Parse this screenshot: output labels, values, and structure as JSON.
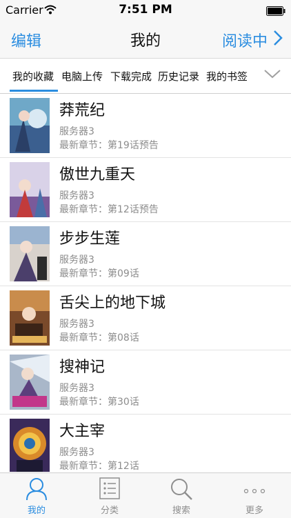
{
  "status": {
    "carrier": "Carrier",
    "time": "7:51 PM"
  },
  "nav": {
    "left": "编辑",
    "title": "我的",
    "right": "阅读中"
  },
  "tabs": [
    "我的收藏",
    "电脑上传",
    "下载完成",
    "历史记录",
    "我的书签"
  ],
  "list": [
    {
      "title": "莽荒纪",
      "server": "服务器3",
      "latest": "最新章节：第19话预告"
    },
    {
      "title": "傲世九重天",
      "server": "服务器3",
      "latest": "最新章节：第12话预告"
    },
    {
      "title": "步步生莲",
      "server": "服务器3",
      "latest": "最新章节：第09话"
    },
    {
      "title": "舌尖上的地下城",
      "server": "服务器3",
      "latest": "最新章节：第08话"
    },
    {
      "title": "搜神记",
      "server": "服务器3",
      "latest": "最新章节：第30话"
    },
    {
      "title": "大主宰",
      "server": "服务器3",
      "latest": "最新章节：第12话"
    }
  ],
  "tabbar": [
    "我的",
    "分类",
    "搜索",
    "更多"
  ],
  "colors": {
    "accent": "#2b8de0",
    "secondary_text": "#8c8c8c"
  },
  "icons": [
    "wifi-icon",
    "battery-icon",
    "chevron-right-icon",
    "chevron-down-icon",
    "person-icon",
    "list-icon",
    "search-icon",
    "more-icon"
  ]
}
